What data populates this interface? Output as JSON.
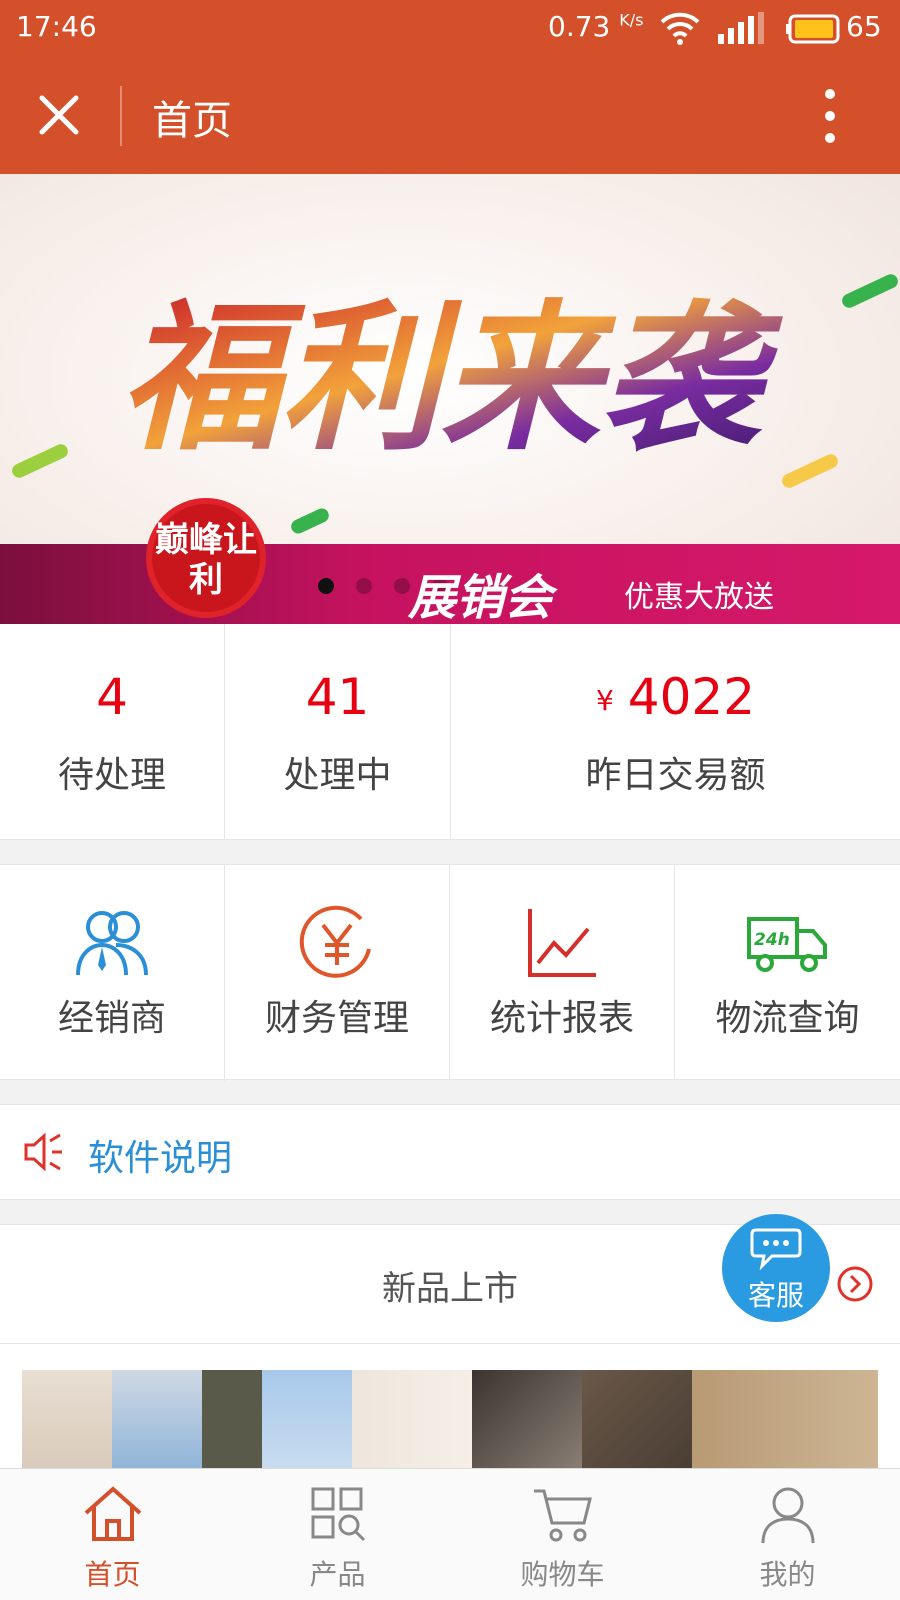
{
  "status_bar": {
    "time": "17:46",
    "net_speed": "0.73",
    "net_unit": "K/s",
    "battery": "65",
    "bg_color": "#d4502a"
  },
  "title_bar": {
    "title": "首页",
    "close_icon": "close-icon",
    "more_icon": "more-vertical-icon"
  },
  "banner": {
    "headline_art": "福利来袭",
    "seal_text": "巅峰让利",
    "expo_text": "展销会",
    "promo_text": "优惠大放送",
    "slide_count": 4,
    "active_slide": 1
  },
  "stats": [
    {
      "value": "4",
      "label": "待处理"
    },
    {
      "value": "41",
      "label": "处理中"
    },
    {
      "currency": "¥",
      "value": "4022",
      "label": "昨日交易额"
    }
  ],
  "menu": [
    {
      "label": "经销商",
      "icon": "users-icon",
      "color": "#2a8fd6"
    },
    {
      "label": "财务管理",
      "icon": "yen-circle-icon",
      "color": "#e0562a"
    },
    {
      "label": "统计报表",
      "icon": "line-chart-icon",
      "color": "#d4302a"
    },
    {
      "label": "物流查询",
      "icon": "delivery-truck-24h-icon",
      "color": "#2aa83a"
    }
  ],
  "notice": {
    "text": "软件说明",
    "icon": "speaker-icon"
  },
  "new_products": {
    "title": "新品上市",
    "arrow_icon": "chevron-right-circle-icon"
  },
  "service": {
    "label": "客服",
    "icon": "chat-bubble-icon"
  },
  "tabs": [
    {
      "label": "首页",
      "icon": "home-icon",
      "active": true
    },
    {
      "label": "产品",
      "icon": "grid-search-icon",
      "active": false
    },
    {
      "label": "购物车",
      "icon": "cart-icon",
      "active": false
    },
    {
      "label": "我的",
      "icon": "user-icon",
      "active": false
    }
  ],
  "colors": {
    "primary": "#d4502a",
    "accent_red": "#e60012",
    "link_blue": "#2a8fd6"
  }
}
